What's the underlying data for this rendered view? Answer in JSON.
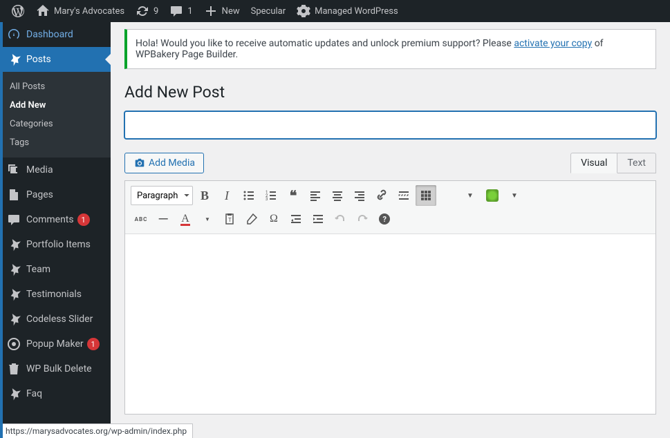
{
  "toolbar": {
    "site_name": "Mary's Advocates",
    "updates_count": "9",
    "comments_count": "1",
    "new_label": "New",
    "specular_label": "Specular",
    "managed_wp_label": "Managed WordPress"
  },
  "sidebar": {
    "dashboard": "Dashboard",
    "posts": "Posts",
    "submenu": {
      "all_posts": "All Posts",
      "add_new": "Add New",
      "categories": "Categories",
      "tags": "Tags"
    },
    "media": "Media",
    "pages": "Pages",
    "comments": "Comments",
    "comments_badge": "1",
    "portfolio": "Portfolio Items",
    "team": "Team",
    "testimonials": "Testimonials",
    "codeless_slider": "Codeless Slider",
    "popup_maker": "Popup Maker",
    "popup_badge": "1",
    "wp_bulk_delete": "WP Bulk Delete",
    "faq": "Faq"
  },
  "notice": {
    "text_before": "Hola! Would you like to receive automatic updates and unlock premium support? Please ",
    "link": "activate your copy",
    "text_after": " of WPBakery Page Builder."
  },
  "page": {
    "heading": "Add New Post",
    "title_value": "",
    "title_placeholder": ""
  },
  "media_button": "Add Media",
  "tabs": {
    "visual": "Visual",
    "text": "Text"
  },
  "format_select": "Paragraph",
  "statusbar_url": "https://marysadvocates.org/wp-admin/index.php"
}
